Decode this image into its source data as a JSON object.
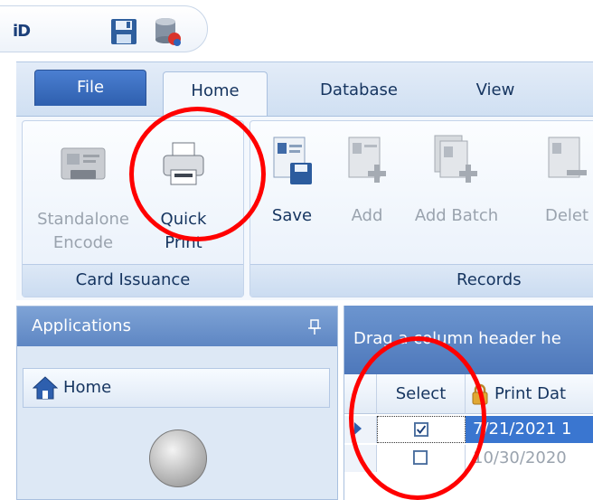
{
  "quick_access": {
    "logo_text": "iD",
    "save_icon": "floppy-disk-icon",
    "database_icon": "database-icon"
  },
  "ribbon": {
    "tabs": [
      {
        "label": "File"
      },
      {
        "label": "Home"
      },
      {
        "label": "Database"
      },
      {
        "label": "View"
      }
    ],
    "active_tab": "Home",
    "groups": {
      "card_issuance": {
        "label": "Card Issuance",
        "buttons": [
          {
            "label": "Standalone Encode",
            "icon": "card-encoder-icon",
            "enabled": false
          },
          {
            "label": "Quick Print",
            "icon": "printer-icon",
            "enabled": true
          }
        ]
      },
      "records": {
        "label": "Records",
        "buttons": [
          {
            "label": "Save",
            "icon": "save-record-icon",
            "enabled": true
          },
          {
            "label": "Add",
            "icon": "add-record-icon",
            "enabled": false
          },
          {
            "label": "Add Batch",
            "icon": "add-batch-icon",
            "enabled": false
          },
          {
            "label": "Delet",
            "icon": "delete-record-icon",
            "enabled": false
          }
        ]
      }
    }
  },
  "applications_pane": {
    "title": "Applications",
    "pin_icon": "pin-icon",
    "items": [
      {
        "label": "Home",
        "icon": "home-icon"
      }
    ]
  },
  "grid": {
    "group_panel_text": "Drag a column header he",
    "columns": [
      {
        "label": "Select"
      },
      {
        "label": "Print Dat",
        "icon": "lock-icon"
      }
    ],
    "rows": [
      {
        "selected": true,
        "checked": true,
        "print_date": "7/21/2021 1"
      },
      {
        "selected": false,
        "checked": false,
        "print_date": "10/30/2020"
      }
    ]
  },
  "colors": {
    "annotation": "#ff0000",
    "selection": "#3a76d0",
    "file_tab": "#2e5fae"
  }
}
